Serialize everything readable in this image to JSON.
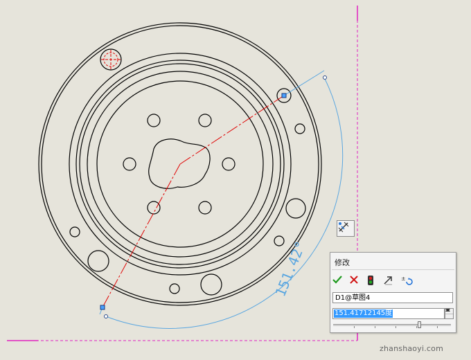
{
  "canvas": {
    "background": "#e6e4db",
    "dimension_text": "151.42°",
    "dimension_color": "#5aa6e0",
    "centerline_color": "#ff0000",
    "border_color": "#e020c0",
    "geometry_color": "#000000"
  },
  "modify_dialog": {
    "title": "修改",
    "toolbar": [
      {
        "icon": "checkmark-icon",
        "color": "#1f9a1f"
      },
      {
        "icon": "close-icon",
        "color": "#d01010"
      },
      {
        "icon": "rebuild-icon",
        "color": "#d01010"
      },
      {
        "icon": "reverse-direction-icon",
        "color": "#333333"
      },
      {
        "icon": "mark-dimension-icon",
        "color": "#1a6ed8"
      }
    ],
    "dimension_name": "D1@草图4",
    "value": "151.41712145度"
  },
  "smart_dimension_button": {
    "icon": "smart-dimension-icon"
  },
  "watermark": "zhanshaoyi.com"
}
